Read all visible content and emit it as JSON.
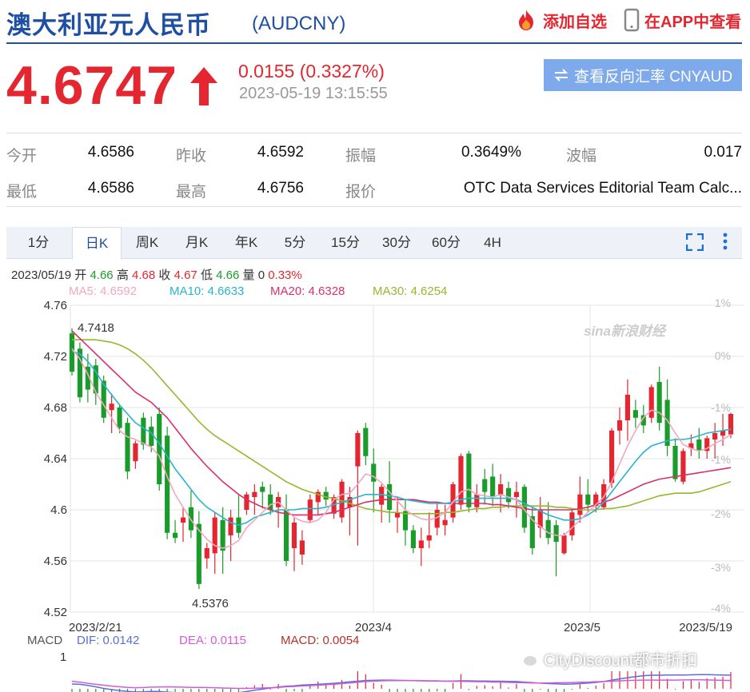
{
  "header": {
    "title": "澳大利亚元人民币",
    "code": "(AUDCNY)",
    "add_favorite": "添加自选",
    "app_view": "在APP中查看",
    "colors": {
      "brand": "#1f4fa3",
      "accent": "#e3262f"
    }
  },
  "quote": {
    "price": "4.6747",
    "change": "0.0155 (0.3327%)",
    "timestamp": "2023-05-19 13:15:55",
    "direction": "up",
    "reverse_button": "查看反向汇率 CNYAUD"
  },
  "stats": {
    "open_label": "今开",
    "open": "4.6586",
    "prev_close_label": "昨收",
    "prev_close": "4.6592",
    "amplitude_label": "振幅",
    "amplitude": "0.3649%",
    "range_label": "波幅",
    "range": "0.017",
    "low_label": "最低",
    "low": "4.6586",
    "high_label": "最高",
    "high": "4.6756",
    "quote_label": "报价",
    "quote_source": "OTC Data Services Editorial Team Calc..."
  },
  "tabs": [
    {
      "label": "1分",
      "active": false
    },
    {
      "label": "日K",
      "active": true
    },
    {
      "label": "周K",
      "active": false
    },
    {
      "label": "月K",
      "active": false
    },
    {
      "label": "年K",
      "active": false
    },
    {
      "label": "5分",
      "active": false
    },
    {
      "label": "15分",
      "active": false
    },
    {
      "label": "30分",
      "active": false
    },
    {
      "label": "60分",
      "active": false
    },
    {
      "label": "4H",
      "active": false
    }
  ],
  "toolbar_icons": [
    "fullscreen-icon",
    "more-vertical-icon"
  ],
  "bar_info": {
    "date": "2023/05/19",
    "open_label": "开",
    "open": "4.66",
    "high_label": "高",
    "high": "4.68",
    "close_label": "收",
    "close": "4.67",
    "low_label": "低",
    "low": "4.66",
    "volume_label": "量",
    "volume": "0",
    "pct": "0.33%"
  },
  "ma": {
    "ma5": "MA5: 4.6592",
    "ma10": "MA10: 4.6633",
    "ma20": "MA20: 4.6328",
    "ma30": "MA30: 4.6254",
    "colors": {
      "ma5": "#f2a7c0",
      "ma10": "#27b4cf",
      "ma20": "#d9306b",
      "ma30": "#95b82e"
    }
  },
  "watermark": "sina新浪财经",
  "chart_data": {
    "type": "candlestick",
    "x_ticks": [
      "2023/2/21",
      "2023/4",
      "2023/5",
      "2023/5/19"
    ],
    "y_ticks": [
      "4.76",
      "4.72",
      "4.68",
      "4.64",
      "4.6",
      "4.56",
      "4.52"
    ],
    "pct_ticks": [
      "1%",
      "0%",
      "-1%",
      "-1%",
      "-2%",
      "-3%",
      "-4%"
    ],
    "ylim": [
      4.52,
      4.76
    ],
    "annotations": {
      "high": "4.7418",
      "low": "4.5376"
    },
    "up_color": "#e3262f",
    "down_color": "#1a9c2b",
    "candles": [
      {
        "o": 4.738,
        "h": 4.742,
        "l": 4.705,
        "c": 4.708
      },
      {
        "o": 4.726,
        "h": 4.731,
        "l": 4.684,
        "c": 4.688
      },
      {
        "o": 4.712,
        "h": 4.722,
        "l": 4.684,
        "c": 4.694
      },
      {
        "o": 4.713,
        "h": 4.718,
        "l": 4.682,
        "c": 4.691
      },
      {
        "o": 4.701,
        "h": 4.705,
        "l": 4.668,
        "c": 4.672
      },
      {
        "o": 4.678,
        "h": 4.691,
        "l": 4.66,
        "c": 4.683
      },
      {
        "o": 4.68,
        "h": 4.682,
        "l": 4.66,
        "c": 4.664
      },
      {
        "o": 4.668,
        "h": 4.672,
        "l": 4.624,
        "c": 4.63
      },
      {
        "o": 4.638,
        "h": 4.654,
        "l": 4.632,
        "c": 4.652
      },
      {
        "o": 4.672,
        "h": 4.676,
        "l": 4.647,
        "c": 4.651
      },
      {
        "o": 4.665,
        "h": 4.673,
        "l": 4.645,
        "c": 4.65
      },
      {
        "o": 4.675,
        "h": 4.68,
        "l": 4.615,
        "c": 4.62
      },
      {
        "o": 4.658,
        "h": 4.665,
        "l": 4.577,
        "c": 4.582
      },
      {
        "o": 4.582,
        "h": 4.592,
        "l": 4.574,
        "c": 4.578
      },
      {
        "o": 4.59,
        "h": 4.602,
        "l": 4.575,
        "c": 4.594
      },
      {
        "o": 4.602,
        "h": 4.615,
        "l": 4.578,
        "c": 4.584
      },
      {
        "o": 4.589,
        "h": 4.599,
        "l": 4.538,
        "c": 4.542
      },
      {
        "o": 4.562,
        "h": 4.574,
        "l": 4.554,
        "c": 4.57
      },
      {
        "o": 4.566,
        "h": 4.598,
        "l": 4.55,
        "c": 4.594
      },
      {
        "o": 4.592,
        "h": 4.602,
        "l": 4.55,
        "c": 4.568
      },
      {
        "o": 4.58,
        "h": 4.6,
        "l": 4.56,
        "c": 4.594
      },
      {
        "o": 4.594,
        "h": 4.612,
        "l": 4.578,
        "c": 4.582
      },
      {
        "o": 4.6,
        "h": 4.614,
        "l": 4.596,
        "c": 4.612
      },
      {
        "o": 4.61,
        "h": 4.62,
        "l": 4.596,
        "c": 4.614
      },
      {
        "o": 4.618,
        "h": 4.622,
        "l": 4.601,
        "c": 4.614
      },
      {
        "o": 4.612,
        "h": 4.62,
        "l": 4.596,
        "c": 4.6
      },
      {
        "o": 4.602,
        "h": 4.614,
        "l": 4.586,
        "c": 4.61
      },
      {
        "o": 4.6,
        "h": 4.612,
        "l": 4.556,
        "c": 4.56
      },
      {
        "o": 4.57,
        "h": 4.594,
        "l": 4.552,
        "c": 4.59
      },
      {
        "o": 4.565,
        "h": 4.584,
        "l": 4.557,
        "c": 4.576
      },
      {
        "o": 4.592,
        "h": 4.612,
        "l": 4.59,
        "c": 4.608
      },
      {
        "o": 4.606,
        "h": 4.616,
        "l": 4.596,
        "c": 4.614
      },
      {
        "o": 4.614,
        "h": 4.618,
        "l": 4.603,
        "c": 4.608
      },
      {
        "o": 4.597,
        "h": 4.612,
        "l": 4.593,
        "c": 4.61
      },
      {
        "o": 4.594,
        "h": 4.624,
        "l": 4.59,
        "c": 4.622
      },
      {
        "o": 4.602,
        "h": 4.618,
        "l": 4.58,
        "c": 4.61
      },
      {
        "o": 4.634,
        "h": 4.662,
        "l": 4.572,
        "c": 4.66
      },
      {
        "o": 4.664,
        "h": 4.668,
        "l": 4.635,
        "c": 4.642
      },
      {
        "o": 4.636,
        "h": 4.648,
        "l": 4.598,
        "c": 4.622
      },
      {
        "o": 4.604,
        "h": 4.62,
        "l": 4.59,
        "c": 4.618
      },
      {
        "o": 4.62,
        "h": 4.638,
        "l": 4.59,
        "c": 4.6
      },
      {
        "o": 4.594,
        "h": 4.61,
        "l": 4.582,
        "c": 4.598
      },
      {
        "o": 4.599,
        "h": 4.608,
        "l": 4.572,
        "c": 4.584
      },
      {
        "o": 4.584,
        "h": 4.588,
        "l": 4.566,
        "c": 4.57
      },
      {
        "o": 4.57,
        "h": 4.586,
        "l": 4.556,
        "c": 4.576
      },
      {
        "o": 4.576,
        "h": 4.598,
        "l": 4.57,
        "c": 4.58
      },
      {
        "o": 4.586,
        "h": 4.606,
        "l": 4.58,
        "c": 4.6
      },
      {
        "o": 4.588,
        "h": 4.604,
        "l": 4.58,
        "c": 4.592
      },
      {
        "o": 4.594,
        "h": 4.622,
        "l": 4.59,
        "c": 4.62
      },
      {
        "o": 4.604,
        "h": 4.644,
        "l": 4.6,
        "c": 4.642
      },
      {
        "o": 4.644,
        "h": 4.646,
        "l": 4.598,
        "c": 4.602
      },
      {
        "o": 4.602,
        "h": 4.62,
        "l": 4.598,
        "c": 4.612
      },
      {
        "o": 4.624,
        "h": 4.632,
        "l": 4.604,
        "c": 4.614
      },
      {
        "o": 4.626,
        "h": 4.636,
        "l": 4.603,
        "c": 4.61
      },
      {
        "o": 4.612,
        "h": 4.628,
        "l": 4.598,
        "c": 4.62
      },
      {
        "o": 4.617,
        "h": 4.622,
        "l": 4.601,
        "c": 4.606
      },
      {
        "o": 4.61,
        "h": 4.622,
        "l": 4.594,
        "c": 4.614
      },
      {
        "o": 4.618,
        "h": 4.62,
        "l": 4.582,
        "c": 4.586
      },
      {
        "o": 4.595,
        "h": 4.602,
        "l": 4.565,
        "c": 4.57
      },
      {
        "o": 4.586,
        "h": 4.61,
        "l": 4.578,
        "c": 4.6
      },
      {
        "o": 4.592,
        "h": 4.606,
        "l": 4.573,
        "c": 4.578
      },
      {
        "o": 4.588,
        "h": 4.592,
        "l": 4.548,
        "c": 4.575
      },
      {
        "o": 4.566,
        "h": 4.582,
        "l": 4.565,
        "c": 4.58
      },
      {
        "o": 4.58,
        "h": 4.6,
        "l": 4.576,
        "c": 4.598
      },
      {
        "o": 4.596,
        "h": 4.626,
        "l": 4.59,
        "c": 4.612
      },
      {
        "o": 4.612,
        "h": 4.624,
        "l": 4.598,
        "c": 4.604
      },
      {
        "o": 4.603,
        "h": 4.614,
        "l": 4.598,
        "c": 4.612
      },
      {
        "o": 4.602,
        "h": 4.624,
        "l": 4.6,
        "c": 4.62
      },
      {
        "o": 4.621,
        "h": 4.664,
        "l": 4.617,
        "c": 4.662
      },
      {
        "o": 4.662,
        "h": 4.68,
        "l": 4.651,
        "c": 4.67
      },
      {
        "o": 4.67,
        "h": 4.702,
        "l": 4.654,
        "c": 4.69
      },
      {
        "o": 4.678,
        "h": 4.686,
        "l": 4.664,
        "c": 4.672
      },
      {
        "o": 4.674,
        "h": 4.682,
        "l": 4.66,
        "c": 4.666
      },
      {
        "o": 4.672,
        "h": 4.698,
        "l": 4.668,
        "c": 4.696
      },
      {
        "o": 4.7,
        "h": 4.712,
        "l": 4.662,
        "c": 4.668
      },
      {
        "o": 4.686,
        "h": 4.702,
        "l": 4.642,
        "c": 4.65
      },
      {
        "o": 4.65,
        "h": 4.656,
        "l": 4.622,
        "c": 4.624
      },
      {
        "o": 4.622,
        "h": 4.648,
        "l": 4.62,
        "c": 4.646
      },
      {
        "o": 4.648,
        "h": 4.659,
        "l": 4.642,
        "c": 4.652
      },
      {
        "o": 4.655,
        "h": 4.664,
        "l": 4.64,
        "c": 4.646
      },
      {
        "o": 4.646,
        "h": 4.658,
        "l": 4.64,
        "c": 4.656
      },
      {
        "o": 4.655,
        "h": 4.668,
        "l": 4.64,
        "c": 4.66
      },
      {
        "o": 4.658,
        "h": 4.675,
        "l": 4.65,
        "c": 4.662
      },
      {
        "o": 4.659,
        "h": 4.676,
        "l": 4.656,
        "c": 4.675
      }
    ],
    "ma_series": {
      "ma5": [
        4.726,
        4.718,
        4.706,
        4.692,
        4.682,
        4.672,
        4.662,
        4.657,
        4.655,
        4.652,
        4.649,
        4.642,
        4.626,
        4.612,
        4.602,
        4.592,
        4.584,
        4.577,
        4.572,
        4.57,
        4.572,
        4.576,
        4.586,
        4.592,
        4.598,
        4.604,
        4.606,
        4.6,
        4.594,
        4.591,
        4.59,
        4.592,
        4.598,
        4.608,
        4.612,
        4.613,
        4.62,
        4.628,
        4.626,
        4.621,
        4.614,
        4.607,
        4.6,
        4.596,
        4.593,
        4.592,
        4.594,
        4.598,
        4.606,
        4.614,
        4.616,
        4.612,
        4.611,
        4.61,
        4.612,
        4.61,
        4.608,
        4.6,
        4.592,
        4.587,
        4.582,
        4.58,
        4.58,
        4.586,
        4.592,
        4.598,
        4.604,
        4.61,
        4.622,
        4.636,
        4.65,
        4.662,
        4.672,
        4.678,
        4.676,
        4.67,
        4.66,
        4.651,
        4.648,
        4.646,
        4.648,
        4.652,
        4.655,
        4.659
      ],
      "ma10": [
        4.724,
        4.722,
        4.716,
        4.708,
        4.698,
        4.69,
        4.682,
        4.675,
        4.668,
        4.664,
        4.66,
        4.652,
        4.642,
        4.632,
        4.624,
        4.616,
        4.608,
        4.602,
        4.598,
        4.594,
        4.59,
        4.588,
        4.59,
        4.594,
        4.596,
        4.598,
        4.6,
        4.6,
        4.6,
        4.601,
        4.601,
        4.601,
        4.602,
        4.604,
        4.606,
        4.608,
        4.61,
        4.612,
        4.612,
        4.612,
        4.611,
        4.61,
        4.608,
        4.607,
        4.606,
        4.605,
        4.605,
        4.605,
        4.606,
        4.608,
        4.609,
        4.609,
        4.609,
        4.609,
        4.609,
        4.609,
        4.608,
        4.605,
        4.602,
        4.599,
        4.596,
        4.594,
        4.592,
        4.592,
        4.593,
        4.596,
        4.6,
        4.606,
        4.614,
        4.622,
        4.63,
        4.638,
        4.645,
        4.65,
        4.652,
        4.654,
        4.655,
        4.655,
        4.656,
        4.658,
        4.66,
        4.661,
        4.662,
        4.663
      ],
      "ma20": [
        4.74,
        4.734,
        4.728,
        4.722,
        4.716,
        4.71,
        4.704,
        4.698,
        4.692,
        4.688,
        4.684,
        4.678,
        4.672,
        4.664,
        4.656,
        4.648,
        4.641,
        4.634,
        4.628,
        4.622,
        4.617,
        4.612,
        4.608,
        4.605,
        4.602,
        4.6,
        4.598,
        4.597,
        4.596,
        4.596,
        4.596,
        4.596,
        4.597,
        4.598,
        4.6,
        4.602,
        4.604,
        4.606,
        4.607,
        4.608,
        4.608,
        4.608,
        4.608,
        4.608,
        4.607,
        4.606,
        4.606,
        4.605,
        4.605,
        4.605,
        4.605,
        4.605,
        4.605,
        4.604,
        4.604,
        4.603,
        4.602,
        4.601,
        4.6,
        4.6,
        4.6,
        4.6,
        4.6,
        4.6,
        4.601,
        4.602,
        4.604,
        4.606,
        4.608,
        4.611,
        4.614,
        4.617,
        4.62,
        4.622,
        4.624,
        4.625,
        4.626,
        4.627,
        4.628,
        4.629,
        4.63,
        4.631,
        4.632,
        4.633
      ],
      "ma30": [
        4.733,
        4.733,
        4.733,
        4.733,
        4.732,
        4.731,
        4.729,
        4.726,
        4.722,
        4.717,
        4.711,
        4.704,
        4.697,
        4.69,
        4.683,
        4.676,
        4.669,
        4.663,
        4.658,
        4.654,
        4.65,
        4.646,
        4.642,
        4.638,
        4.634,
        4.63,
        4.626,
        4.622,
        4.619,
        4.616,
        4.614,
        4.612,
        4.61,
        4.609,
        4.607,
        4.605,
        4.603,
        4.601,
        4.6,
        4.599,
        4.598,
        4.598,
        4.597,
        4.597,
        4.597,
        4.597,
        4.597,
        4.598,
        4.598,
        4.599,
        4.6,
        4.601,
        4.601,
        4.602,
        4.602,
        4.603,
        4.603,
        4.603,
        4.603,
        4.603,
        4.603,
        4.602,
        4.602,
        4.601,
        4.6,
        4.6,
        4.6,
        4.601,
        4.601,
        4.602,
        4.603,
        4.605,
        4.607,
        4.609,
        4.611,
        4.612,
        4.613,
        4.613,
        4.613,
        4.614,
        4.616,
        4.618,
        4.62,
        4.622
      ]
    }
  },
  "macd": {
    "label": "MACD",
    "dif": "DIF: 0.0142",
    "dea": "DEA: 0.0115",
    "macd": "MACD: 0.0054",
    "y_tick": "1",
    "colors": {
      "dif": "#5a6fd6",
      "dea": "#d35cd6",
      "macd": "#b0342c"
    }
  },
  "overlay": {
    "wechat_text": "CityDiscount都市折扣"
  }
}
